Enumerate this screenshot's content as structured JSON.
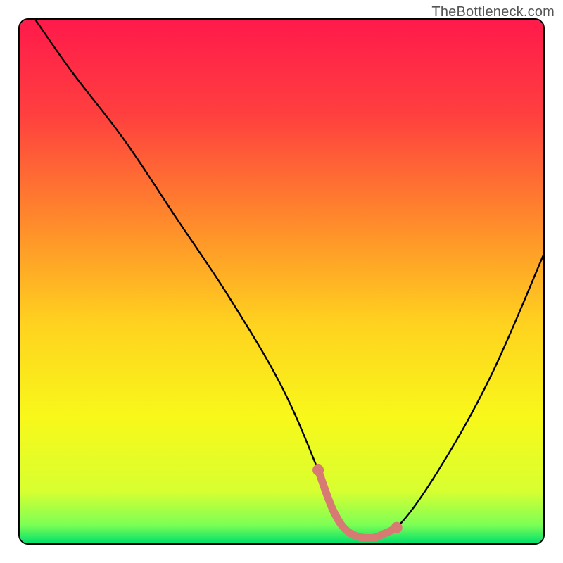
{
  "watermark": "TheBottleneck.com",
  "chart_data": {
    "type": "line",
    "title": "",
    "xlabel": "",
    "ylabel": "",
    "xlim": [
      0,
      100
    ],
    "ylim": [
      0,
      100
    ],
    "gradient_stops": [
      {
        "offset": 0.0,
        "color": "#ff1a4b"
      },
      {
        "offset": 0.18,
        "color": "#ff3f3f"
      },
      {
        "offset": 0.4,
        "color": "#ff8f2a"
      },
      {
        "offset": 0.58,
        "color": "#ffd21f"
      },
      {
        "offset": 0.76,
        "color": "#f8f81a"
      },
      {
        "offset": 0.9,
        "color": "#d8ff30"
      },
      {
        "offset": 0.965,
        "color": "#7cff55"
      },
      {
        "offset": 1.0,
        "color": "#00e06a"
      }
    ],
    "series": [
      {
        "name": "bottleneck-curve",
        "color": "#000000",
        "x": [
          3,
          10,
          20,
          30,
          40,
          50,
          57,
          60,
          63,
          67,
          72,
          80,
          90,
          100
        ],
        "y": [
          100,
          90,
          77,
          62,
          47,
          30,
          14,
          6,
          2,
          1,
          3,
          14,
          32,
          55
        ]
      },
      {
        "name": "sweet-spot",
        "color": "#d87a74",
        "x": [
          57,
          60,
          63,
          67,
          70,
          72
        ],
        "y": [
          14,
          6,
          2,
          1,
          2,
          3
        ]
      }
    ],
    "sweet_spot_endpoints": {
      "left": {
        "x": 57,
        "y": 14
      },
      "right": {
        "x": 72,
        "y": 3
      }
    }
  }
}
